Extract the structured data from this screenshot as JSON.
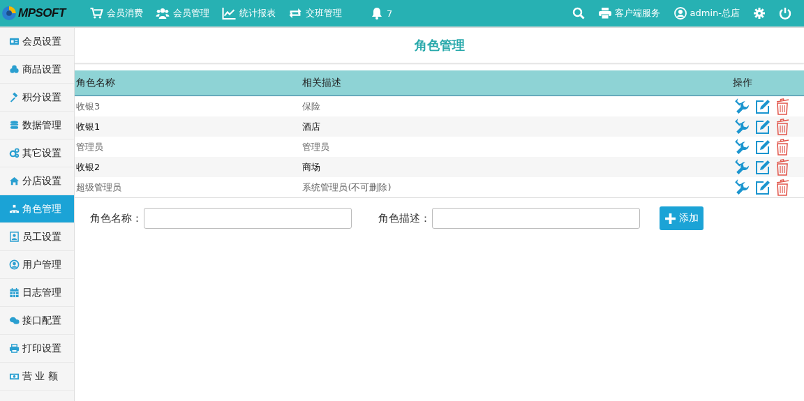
{
  "topbar": {
    "logo": "MPSOFT",
    "nav": [
      "会员消费",
      "会员管理",
      "统计报表",
      "交班管理"
    ],
    "notifications": "7",
    "client_service": "客户端服务",
    "user": "admin-总店"
  },
  "sidebar": {
    "items": [
      {
        "label": "会员设置",
        "selected": false
      },
      {
        "label": "商品设置",
        "selected": false
      },
      {
        "label": "积分设置",
        "selected": false
      },
      {
        "label": "数据管理",
        "selected": false
      },
      {
        "label": "其它设置",
        "selected": false
      },
      {
        "label": "分店设置",
        "selected": false
      },
      {
        "label": "角色管理",
        "selected": true
      },
      {
        "label": "员工设置",
        "selected": false
      },
      {
        "label": "用户管理",
        "selected": false
      },
      {
        "label": "日志管理",
        "selected": false
      },
      {
        "label": "接口配置",
        "selected": false
      },
      {
        "label": "打印设置",
        "selected": false
      },
      {
        "label": "营 业 额",
        "selected": false
      }
    ]
  },
  "page_title": "角色管理",
  "table": {
    "columns": [
      "角色名称",
      "相关描述",
      "操作"
    ],
    "rows": [
      {
        "name": "收银3",
        "description": "保险"
      },
      {
        "name": "收银1",
        "description": "酒店"
      },
      {
        "name": "管理员",
        "description": "管理员"
      },
      {
        "name": "收银2",
        "description": "商场"
      },
      {
        "name": "超级管理员",
        "description": "系统管理员(不可删除)"
      }
    ]
  },
  "form": {
    "name_label": "角色名称：",
    "description_label": "角色描述：",
    "add_button": "添加"
  }
}
